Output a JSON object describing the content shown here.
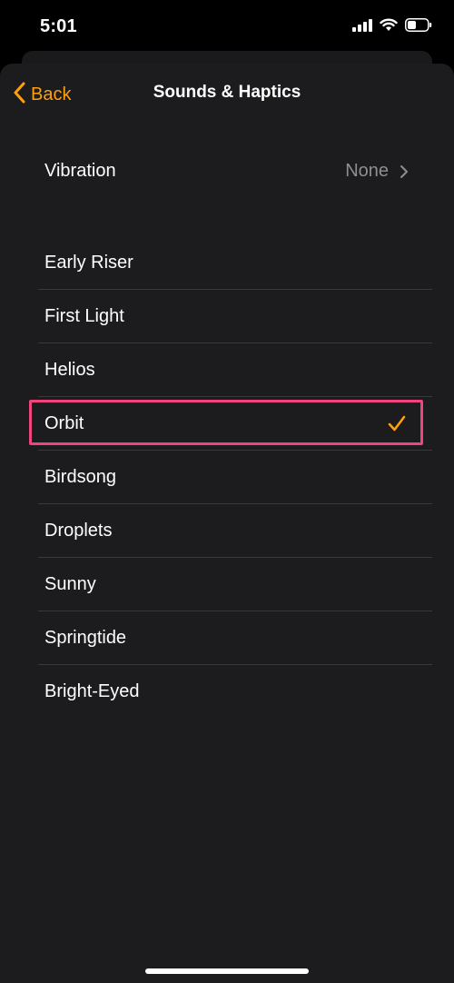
{
  "status_bar": {
    "time": "5:01",
    "icons": [
      "cellular-signal-icon",
      "wifi-icon",
      "battery-icon"
    ]
  },
  "nav": {
    "back_label": "Back",
    "title": "Sounds & Haptics"
  },
  "vibration": {
    "label": "Vibration",
    "value": "None"
  },
  "tones": [
    {
      "label": "Early Riser",
      "selected": false
    },
    {
      "label": "First Light",
      "selected": false
    },
    {
      "label": "Helios",
      "selected": false
    },
    {
      "label": "Orbit",
      "selected": true
    },
    {
      "label": "Birdsong",
      "selected": false
    },
    {
      "label": "Droplets",
      "selected": false
    },
    {
      "label": "Sunny",
      "selected": false
    },
    {
      "label": "Springtide",
      "selected": false
    },
    {
      "label": "Bright-Eyed",
      "selected": false
    }
  ],
  "colors": {
    "accent": "#ff9f0a",
    "background": "#1c1c1e",
    "highlight": "#f0447c"
  }
}
